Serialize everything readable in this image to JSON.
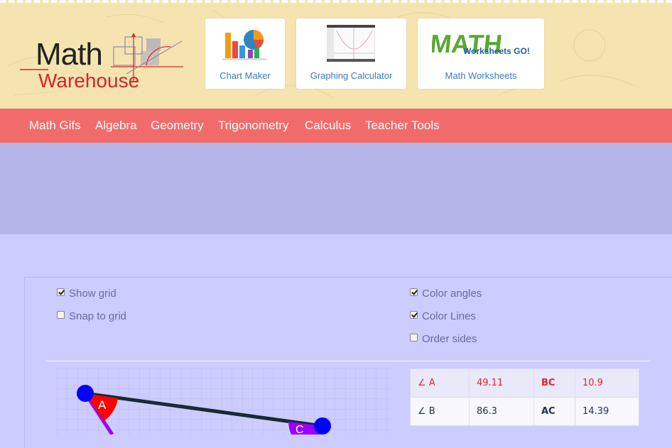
{
  "logo": {
    "line1": "Math",
    "line2": "Warehouse"
  },
  "tiles": [
    {
      "label": "Chart Maker",
      "icon": "chart-icon"
    },
    {
      "label": "Graphing Calculator",
      "icon": "graph-thumbnail-icon"
    },
    {
      "label": "Math Worksheets",
      "icon": "math-worksheets-go-logo",
      "logo_text_main": "MATH",
      "logo_text_sub": "Worksheets GO!"
    }
  ],
  "nav": [
    "Math Gifs",
    "Algebra",
    "Geometry",
    "Trigonometry",
    "Calculus",
    "Teacher Tools"
  ],
  "options": {
    "show_grid": {
      "label": "Show grid",
      "checked": true
    },
    "snap_to_grid": {
      "label": "Snap to grid",
      "checked": false
    },
    "color_angles": {
      "label": "Color angles",
      "checked": true
    },
    "color_lines": {
      "label": "Color Lines",
      "checked": true
    },
    "order_sides": {
      "label": "Order sides",
      "checked": false
    }
  },
  "triangle": {
    "vertex_labels": [
      "A",
      "C"
    ]
  },
  "measurements": [
    {
      "angle": "∠ A",
      "angle_value": "49.11",
      "side": "BC",
      "side_value": "10.9"
    },
    {
      "angle": "∠ B",
      "angle_value": "86.3",
      "side": "AC",
      "side_value": "14.39"
    }
  ],
  "colors": {
    "nav": "#f26b6b",
    "header": "#f6e4b0",
    "page": "#ccccff",
    "band": "#b4b4e6",
    "vertex": "#0000ff",
    "angle_a": "#ff0000"
  }
}
